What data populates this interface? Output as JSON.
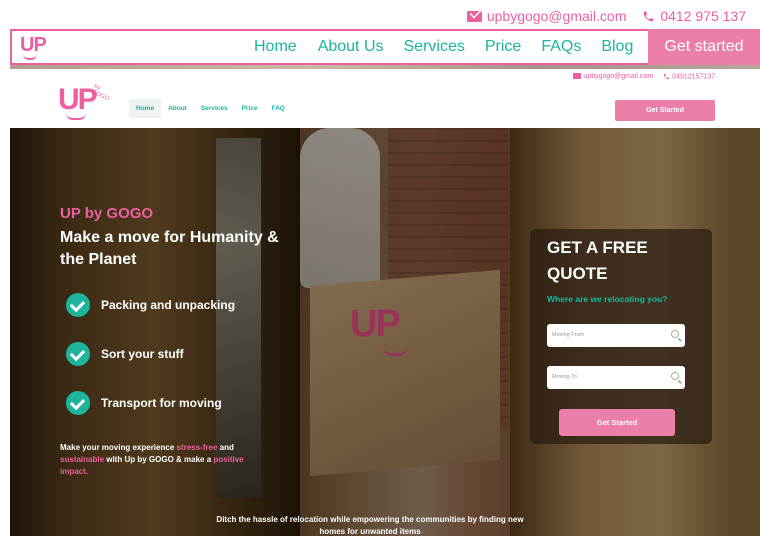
{
  "top_contact": {
    "email": "upbygogo@gmail.com",
    "phone": "0412 975 137"
  },
  "nav": {
    "logo": "UP",
    "links": [
      "Home",
      "About Us",
      "Services",
      "Price",
      "FAQs",
      "Blog"
    ],
    "cta": "Get started"
  },
  "inner_site": {
    "contact": {
      "email": "upbygogo@gmail.com",
      "phone": "04912157137"
    },
    "logo": "UP",
    "logo_tag": "by GOGO",
    "nav": [
      "Home",
      "About",
      "Services",
      "Price",
      "FAQ"
    ],
    "cta": "Get Started",
    "hero": {
      "brand": "UP by GOGO",
      "title": "Make a move for Humanity & the Planet",
      "features": [
        "Packing and unpacking",
        "Sort your stuff",
        "Transport for moving"
      ],
      "desc_part1": "Make your moving experience ",
      "desc_stress": "stress-free",
      "desc_part2": " and ",
      "desc_sustainable": "sustainable",
      "desc_part3": " with Up by GOGO & make a ",
      "desc_positive": "positive impact.",
      "footer_text": "Ditch the hassle of relocation while empowering the communities by finding new homes for unwanted items",
      "box_logo": "UP"
    },
    "quote": {
      "title": "GET A FREE QUOTE",
      "subtitle": "Where are we relocating you?",
      "from_placeholder": "Moving From",
      "to_placeholder": "Moving To",
      "button": "Get Started"
    }
  },
  "colors": {
    "pink": "#ec5fa0",
    "teal": "#1cb49c",
    "button_pink": "#ec7faa"
  }
}
